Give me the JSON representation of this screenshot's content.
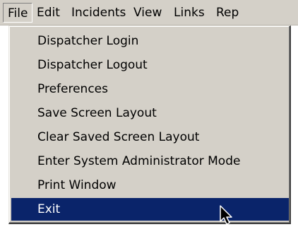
{
  "menubar": {
    "items": [
      {
        "label": "File"
      },
      {
        "label": "Edit"
      },
      {
        "label": "Incidents"
      },
      {
        "label": "View"
      },
      {
        "label": "Links"
      },
      {
        "label": "Rep"
      }
    ]
  },
  "file_menu": {
    "items": [
      {
        "label": "Dispatcher Login"
      },
      {
        "label": "Dispatcher Logout"
      },
      {
        "label": "Preferences"
      },
      {
        "label": "Save Screen Layout"
      },
      {
        "label": "Clear Saved Screen Layout"
      },
      {
        "label": "Enter System Administrator Mode"
      },
      {
        "label": "Print Window"
      },
      {
        "label": "Exit"
      }
    ],
    "highlighted_item": "Exit"
  },
  "colors": {
    "menu_background": "#d4d0c8",
    "highlight": "#0a246a",
    "highlight_text": "#ffffff"
  },
  "cursor_icon": "arrow-pointer-icon"
}
